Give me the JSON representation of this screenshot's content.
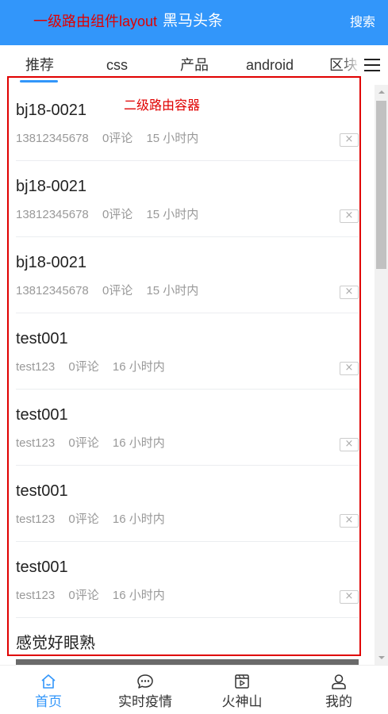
{
  "navbar": {
    "annotation": "一级路由组件layout",
    "title": "黑马头条",
    "search_label": "搜索"
  },
  "tabs": [
    "推荐",
    "css",
    "产品",
    "android",
    "区块"
  ],
  "active_tab": 0,
  "router_annotation": "二级路由容器",
  "articles": [
    {
      "title": "bj18-0021",
      "author": "13812345678",
      "comments": "0评论",
      "time": "15 小时内"
    },
    {
      "title": "bj18-0021",
      "author": "13812345678",
      "comments": "0评论",
      "time": "15 小时内"
    },
    {
      "title": "bj18-0021",
      "author": "13812345678",
      "comments": "0评论",
      "time": "15 小时内"
    },
    {
      "title": "test001",
      "author": "test123",
      "comments": "0评论",
      "time": "16 小时内"
    },
    {
      "title": "test001",
      "author": "test123",
      "comments": "0评论",
      "time": "16 小时内"
    },
    {
      "title": "test001",
      "author": "test123",
      "comments": "0评论",
      "time": "16 小时内"
    },
    {
      "title": "test001",
      "author": "test123",
      "comments": "0评论",
      "time": "16 小时内"
    }
  ],
  "partial_article_title": "感觉好眼熟",
  "close_glyph": "×",
  "tabbar": [
    {
      "label": "首页",
      "icon": "home-icon"
    },
    {
      "label": "实时疫情",
      "icon": "chat-icon"
    },
    {
      "label": "火神山",
      "icon": "video-icon"
    },
    {
      "label": "我的",
      "icon": "user-icon"
    }
  ],
  "colors": {
    "primary": "#3296fa",
    "annotation_red": "#e00000",
    "meta_gray": "#999999"
  }
}
